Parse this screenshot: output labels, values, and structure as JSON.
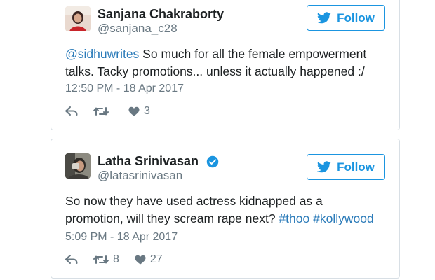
{
  "colors": {
    "accent": "#1b95e0",
    "link": "#2b7bb9",
    "text": "#1c2022",
    "muted": "#697882",
    "border": "#d8dfe5"
  },
  "tweets": [
    {
      "author_name": "Sanjana Chakraborty",
      "handle": "@sanjana_c28",
      "verified": false,
      "follow_label": "Follow",
      "text_mention": "@sidhuwrites",
      "text_line1_rest": " So much for all the female empowerment",
      "text_line2": "talks. Tacky promotions... unless it actually happened :/",
      "timestamp": "12:50 PM - 18 Apr 2017",
      "reply_icon": "reply-icon",
      "retweet_count": "",
      "like_count": "3"
    },
    {
      "author_name": "Latha Srinivasan",
      "handle": "@latasrinivasan",
      "verified": true,
      "follow_label": "Follow",
      "text_line1": "So now they have used actress kidnapped as a",
      "text_line2_plain": "promotion, will they scream rape next? ",
      "hashtag1": "#thoo",
      "hashtag2": "#kollywood",
      "timestamp": "5:09 PM - 18 Apr 2017",
      "reply_icon": "reply-icon",
      "retweet_count": "8",
      "like_count": "27"
    }
  ]
}
